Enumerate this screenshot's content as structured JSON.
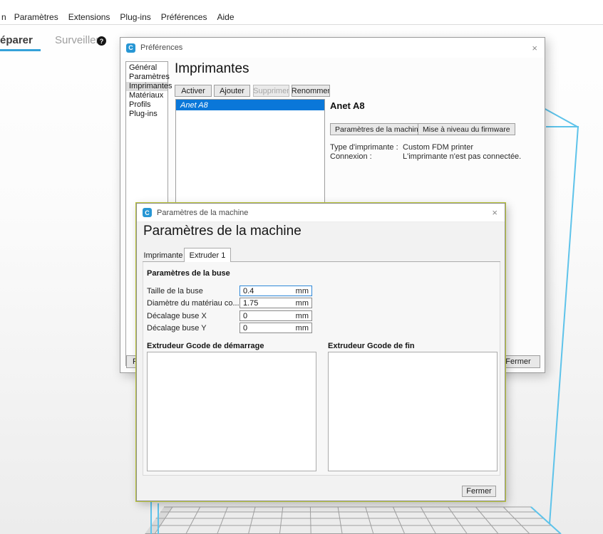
{
  "menu_bar": {
    "partial_item": "n",
    "items": [
      "Paramètres",
      "Extensions",
      "Plug-ins",
      "Préférences",
      "Aide"
    ]
  },
  "stage_tabs": {
    "prepare_partial": "éparer",
    "monitor": "Surveiller",
    "monitor_badge": "?"
  },
  "preferences_dialog": {
    "title": "Préférences",
    "logo_letter": "C",
    "close_glyph": "×",
    "sidebar": [
      "Général",
      "Paramètres",
      "Imprimantes",
      "Matériaux",
      "Profils",
      "Plug-ins"
    ],
    "heading": "Imprimantes",
    "toolbar": {
      "activate": "Activer",
      "add": "Ajouter",
      "remove": "Supprimer",
      "rename": "Renommer"
    },
    "printer_list": [
      {
        "name": "Anet A8",
        "selected": true
      }
    ],
    "detail": {
      "printer_name": "Anet A8",
      "machine_settings_button": "Paramètres de la machine",
      "firmware_button": "Mise à niveau du firmware",
      "rows": [
        {
          "label": "Type d'imprimante :",
          "value": "Custom FDM printer"
        },
        {
          "label": "Connexion :",
          "value": "L'imprimante n'est pas connectée."
        }
      ]
    },
    "defaults_button_partial": "R",
    "close_button": "Fermer"
  },
  "machine_dialog": {
    "title": "Paramètres de la machine",
    "logo_letter": "C",
    "close_glyph": "×",
    "heading": "Paramètres de la machine",
    "tabs": [
      {
        "label": "Imprimante",
        "active": false
      },
      {
        "label": "Extruder 1",
        "active": true
      }
    ],
    "section_title": "Paramètres de la buse",
    "fields": [
      {
        "label": "Taille de la buse",
        "value": "0.4",
        "unit": "mm",
        "focused": true
      },
      {
        "label": "Diamètre du matériau co...",
        "value": "1.75",
        "unit": "mm",
        "focused": false
      },
      {
        "label": "Décalage buse X",
        "value": "0",
        "unit": "mm",
        "focused": false
      },
      {
        "label": "Décalage buse Y",
        "value": "0",
        "unit": "mm",
        "focused": false
      }
    ],
    "gcode": {
      "start_label": "Extrudeur Gcode de démarrage",
      "end_label": "Extrudeur Gcode de fin",
      "start_value": "",
      "end_value": ""
    },
    "close_button": "Fermer"
  },
  "colors": {
    "selection_blue": "#0a77d9",
    "cura_logo_blue": "#2796d4",
    "stage_underline_blue": "#35a2d9",
    "wireframe_blue": "#5ec3ea",
    "machine_dialog_outline_green": "#b9c437"
  }
}
